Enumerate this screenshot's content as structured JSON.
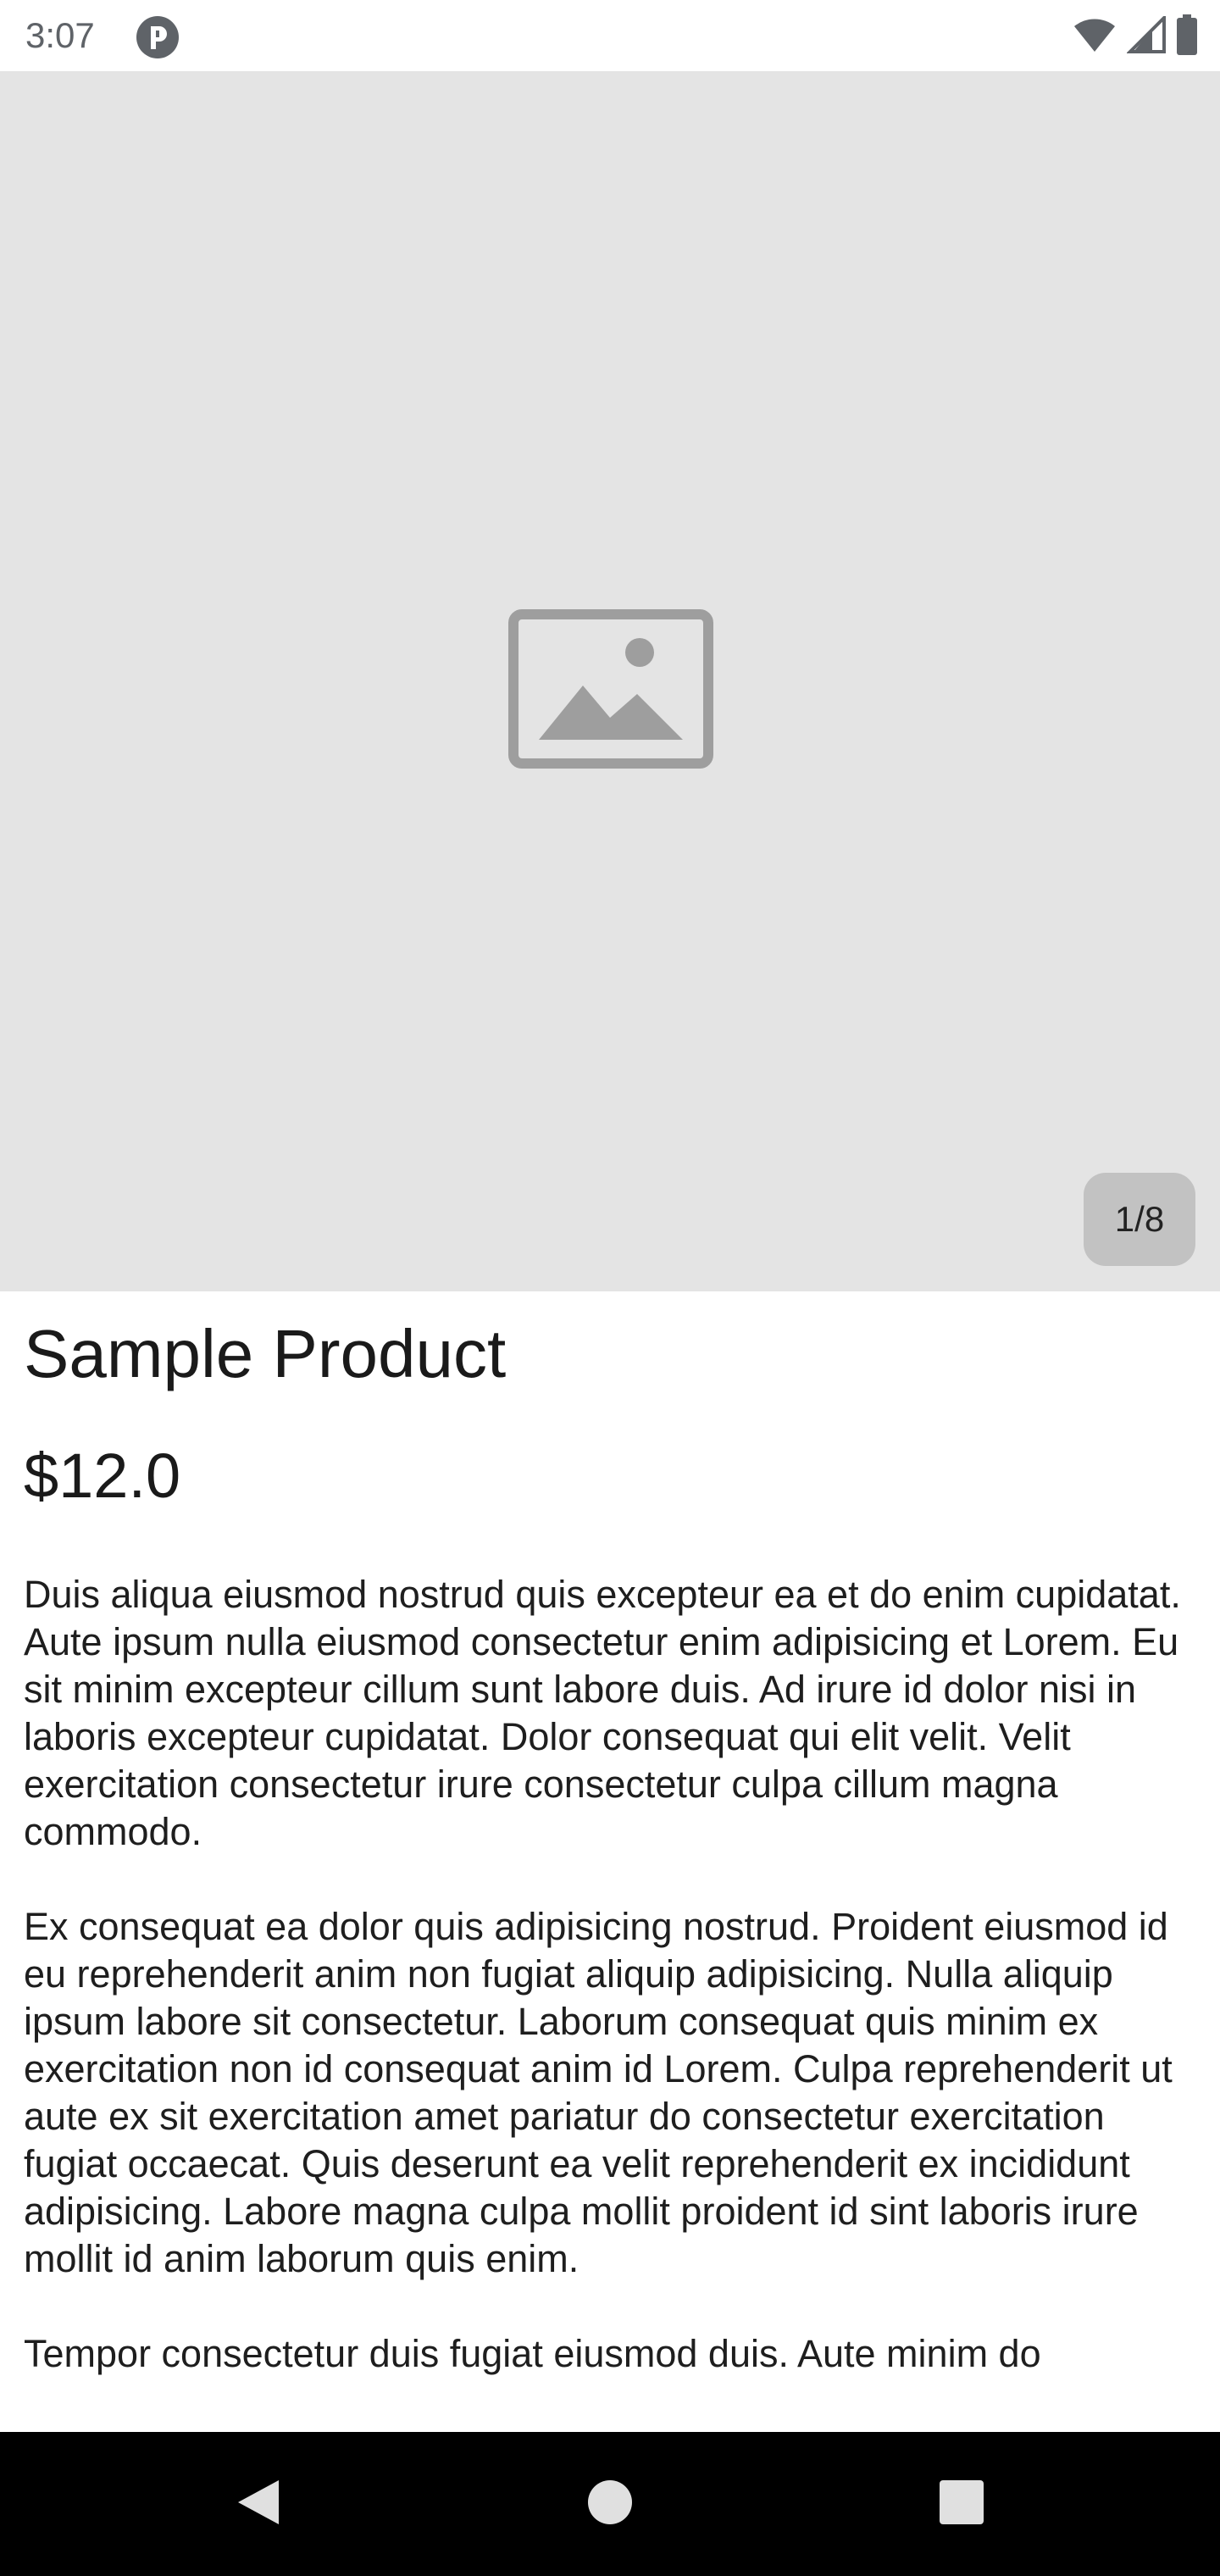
{
  "status_bar": {
    "time": "3:07",
    "app_icon": "pocket-casts-like-icon",
    "icons": [
      "wifi-icon",
      "cell-signal-icon",
      "battery-icon"
    ]
  },
  "gallery": {
    "placeholder_icon": "image-placeholder-icon",
    "counter": "1/8",
    "background_color": "#e4e4e4"
  },
  "product": {
    "title": "Sample Product",
    "price": "$12.0",
    "description": [
      "Duis aliqua eiusmod nostrud quis excepteur ea et do enim cupidatat. Aute ipsum nulla eiusmod consectetur enim adipisicing et Lorem. Eu sit minim excepteur cillum sunt labore duis. Ad irure id dolor nisi in laboris excepteur cupidatat. Dolor consequat qui elit velit. Velit exercitation consectetur irure consectetur culpa cillum magna commodo.",
      "Ex consequat ea dolor quis adipisicing nostrud. Proident eiusmod id eu reprehenderit anim non fugiat aliquip adipisicing. Nulla aliquip ipsum labore sit consectetur. Laborum consequat quis minim ex exercitation non id consequat anim id Lorem. Culpa reprehenderit ut aute ex sit exercitation amet pariatur do consectetur exercitation fugiat occaecat. Quis deserunt ea velit reprehenderit ex incididunt adipisicing. Labore magna culpa mollit proident id sint laboris irure mollit id anim laborum quis enim.",
      "Tempor consectetur duis fugiat eiusmod duis. Aute minim do"
    ]
  },
  "nav_bar": {
    "icons": [
      "back-icon",
      "home-icon",
      "recents-icon"
    ]
  }
}
